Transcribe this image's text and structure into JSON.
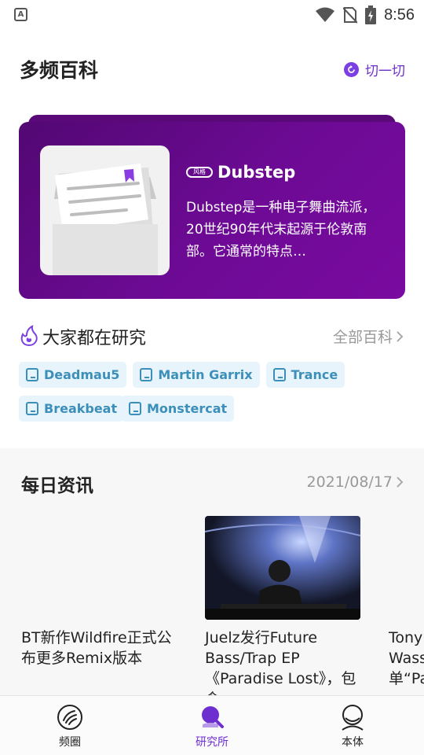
{
  "status_bar": {
    "time": "8:56",
    "app_icon_letter": "A"
  },
  "header": {
    "title": "多频百科",
    "switch_label": "切一切"
  },
  "hero": {
    "tag": "风格",
    "title": "Dubstep",
    "description": "Dubstep是一种电子舞曲流派，20世纪90年代末起源于伦敦南部。它通常的特点…"
  },
  "research": {
    "title": "大家都在研究",
    "all_link": "全部百科",
    "chips": [
      "Deadmau5",
      "Martin Garrix",
      "Trance",
      "Breakbeat",
      "Monstercat"
    ]
  },
  "news": {
    "title": "每日资讯",
    "date": "2021/08/17",
    "items": [
      {
        "text": "BT新作Wildfire正式公布更多Remix版本"
      },
      {
        "text": "Juelz发行Future Bass/Trap EP《Paradise Lost》，包含…"
      },
      {
        "text": "Tony Wass 单“Pa"
      }
    ]
  },
  "bottom_nav": {
    "items": [
      {
        "label": "频圈"
      },
      {
        "label": "研究所",
        "active": true
      },
      {
        "label": "本体"
      }
    ]
  },
  "colors": {
    "accent": "#6e2fd0",
    "card_bg": "#6d0a95",
    "chip_text": "#3c8fba",
    "chip_bg": "#e7f4fb"
  }
}
